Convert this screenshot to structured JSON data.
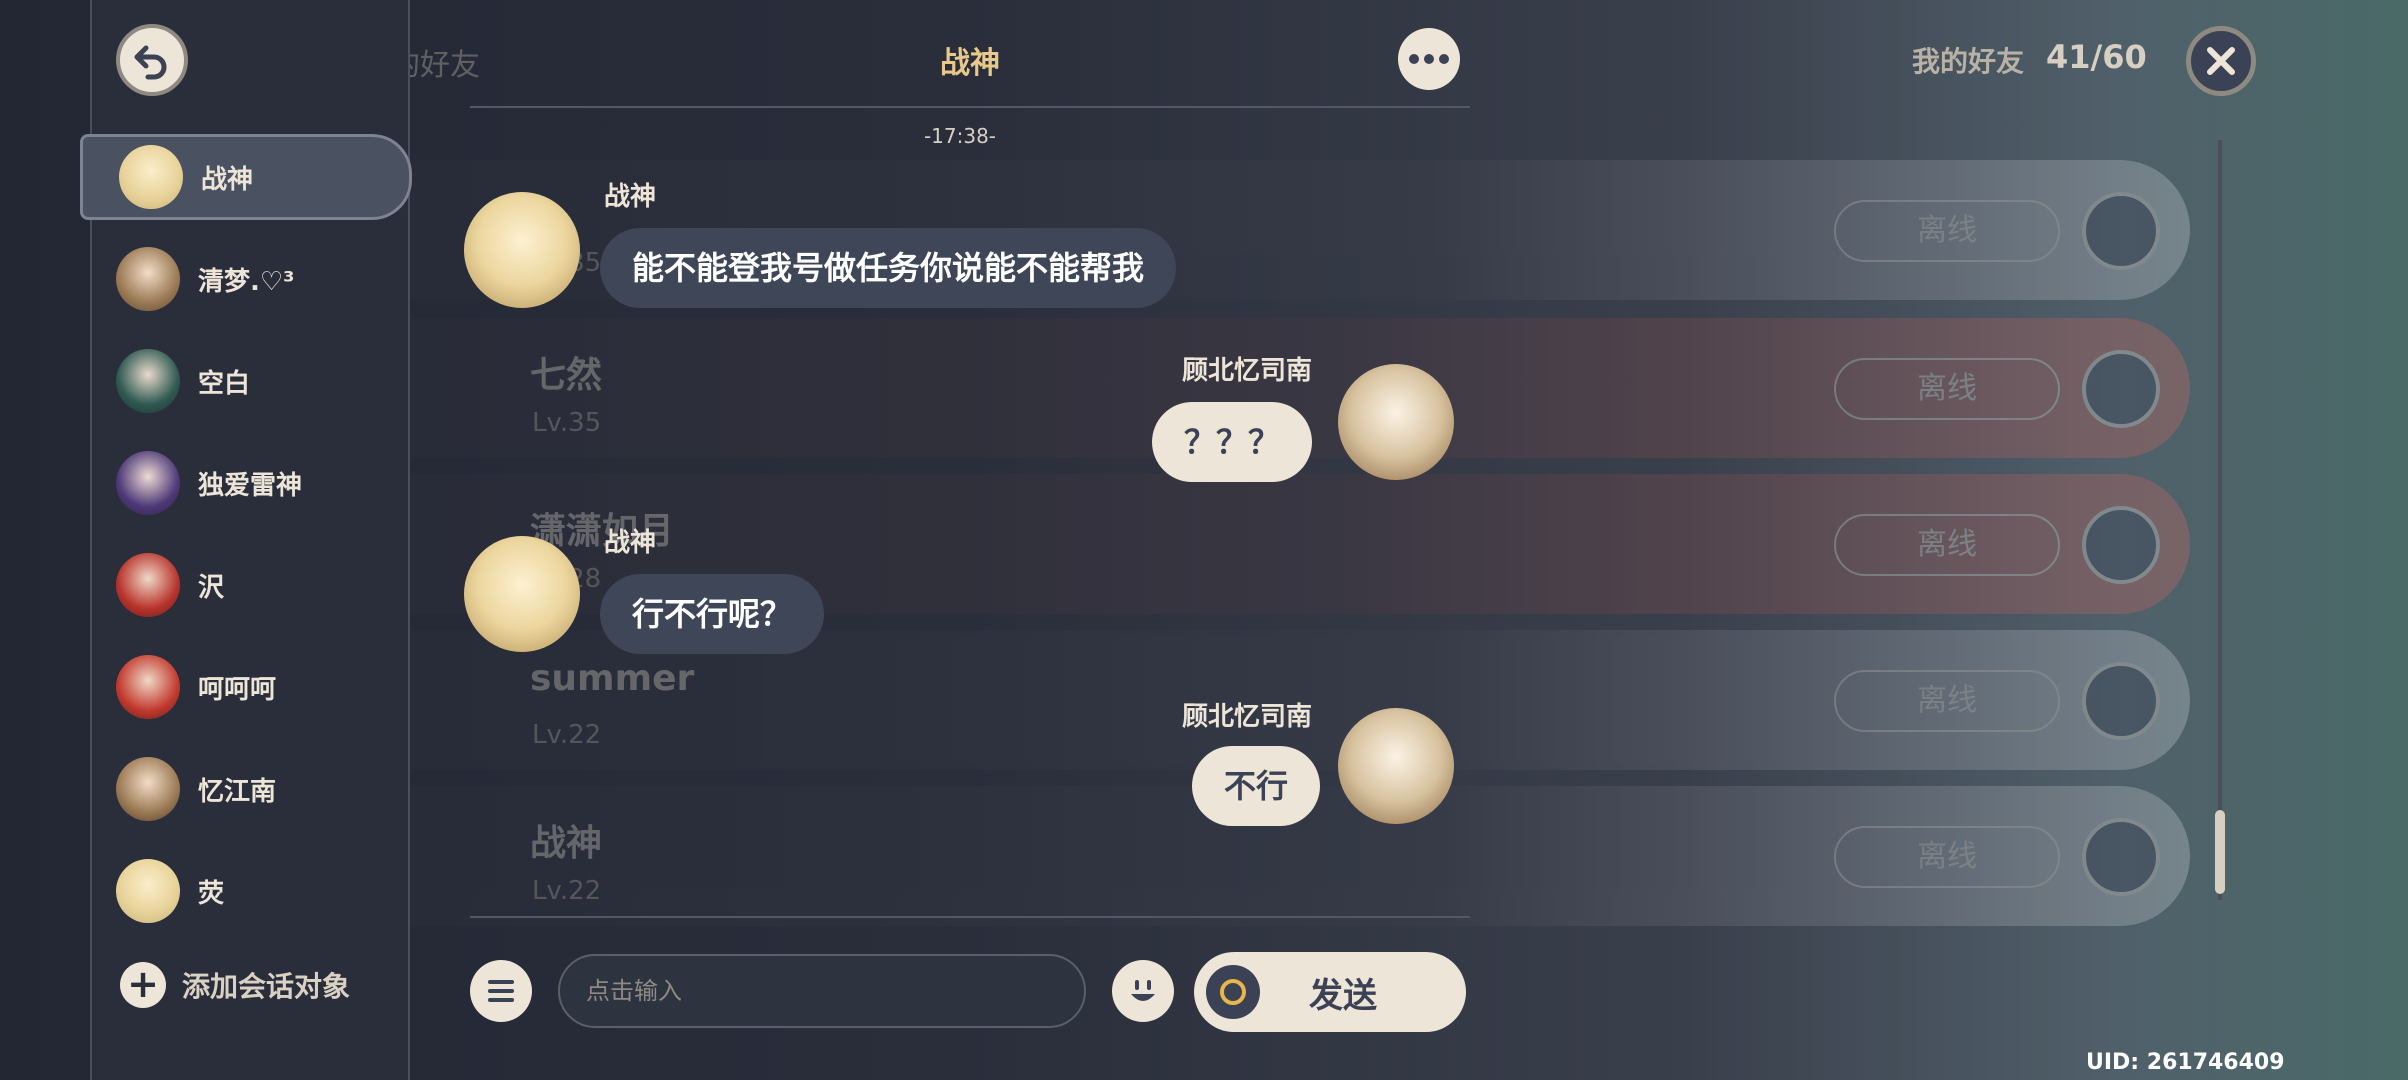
{
  "header": {
    "chat_title": "战神",
    "friends_label": "我的好友",
    "friends_count": "41/60",
    "bg_title": "我的好友"
  },
  "sidebar": {
    "contacts": [
      {
        "label": "战神",
        "active": true
      },
      {
        "label": "清梦.♡³"
      },
      {
        "label": "空白"
      },
      {
        "label": "独爱雷神"
      },
      {
        "label": "沢"
      },
      {
        "label": "呵呵呵"
      },
      {
        "label": "忆江南"
      },
      {
        "label": "荧"
      }
    ],
    "add_label": "添加会话对象"
  },
  "chat": {
    "timestamp": "-17:38-",
    "messages": [
      {
        "sender": "战神",
        "side": "left",
        "text": "能不能登我号做任务你说能不能帮我"
      },
      {
        "sender": "顾北忆司南",
        "side": "right",
        "text": "？？？"
      },
      {
        "sender": "战神",
        "side": "left",
        "text": "行不行呢？"
      },
      {
        "sender": "顾北忆司南",
        "side": "right",
        "text": "不行"
      }
    ]
  },
  "background_friends": [
    {
      "name": "",
      "level": "Lv.35",
      "status": "离线",
      "variant": "plain"
    },
    {
      "name": "七然",
      "level": "Lv.35",
      "status": "离线",
      "variant": "red"
    },
    {
      "name": "潇潇如月",
      "level": "Lv.28",
      "status": "离线",
      "variant": "red"
    },
    {
      "name": "summer",
      "level": "Lv.22",
      "status": "离线",
      "variant": "plain"
    },
    {
      "name": "战神",
      "level": "Lv.22",
      "status": "离线",
      "variant": "plain"
    }
  ],
  "input": {
    "placeholder": "点击输入",
    "send_label": "发送"
  },
  "uid": "UID: 261746409",
  "colors": {
    "accent_gold": "#e8c98a",
    "cream": "#ece5d8",
    "panel": "#2a2e3b",
    "bubble_dark": "#3e4657"
  }
}
